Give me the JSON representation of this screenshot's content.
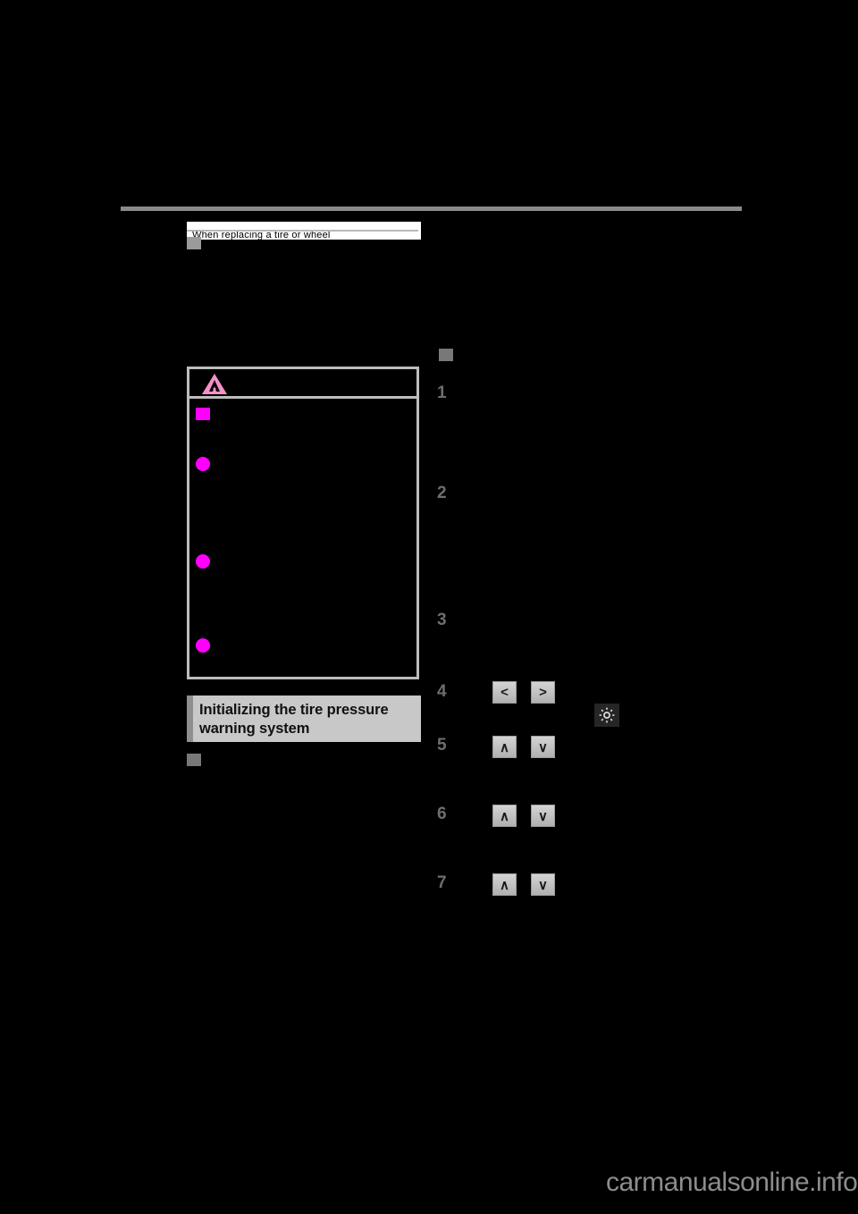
{
  "page": {
    "background_color": "#000000",
    "rule_color": "#8a8a8a"
  },
  "left_column": {
    "subsection_heading": {
      "marker_label": "subsection-marker",
      "text": "When replacing a tire or wheel"
    },
    "warning_box": {
      "icon_name": "warning-triangle-icon",
      "icon_color": "#f591c8",
      "title": "",
      "bullets": [
        {
          "marker": "square",
          "color": "#ff00ff",
          "text": ""
        },
        {
          "marker": "circle",
          "color": "#ff00ff",
          "text": ""
        },
        {
          "marker": "circle",
          "color": "#ff00ff",
          "text": ""
        },
        {
          "marker": "circle",
          "color": "#ff00ff",
          "text": ""
        }
      ]
    },
    "section_heading": {
      "line1": "Initializing the tire pressure",
      "line2": "warning system",
      "background_color": "#c8c8c8",
      "accent_color": "#8f8f8f"
    },
    "trailing_marker_label": "subsection-marker"
  },
  "right_column": {
    "subsection_marker_label": "subsection-marker",
    "steps": [
      {
        "number": "1",
        "text": ""
      },
      {
        "number": "2",
        "text": ""
      },
      {
        "number": "3",
        "text": ""
      },
      {
        "number": "4",
        "text": "",
        "buttons": [
          "<",
          ">"
        ]
      },
      {
        "number": "5",
        "text": "",
        "buttons": [
          "∧",
          "∨"
        ]
      },
      {
        "number": "6",
        "text": "",
        "buttons": [
          "∧",
          "∨"
        ]
      },
      {
        "number": "7",
        "text": "",
        "buttons": [
          "∧",
          "∨"
        ]
      }
    ],
    "settings_icon": {
      "name": "gear-icon",
      "label": ""
    }
  },
  "watermark": {
    "text": "carmanualsonline.info",
    "color": "#8d8d8d"
  }
}
